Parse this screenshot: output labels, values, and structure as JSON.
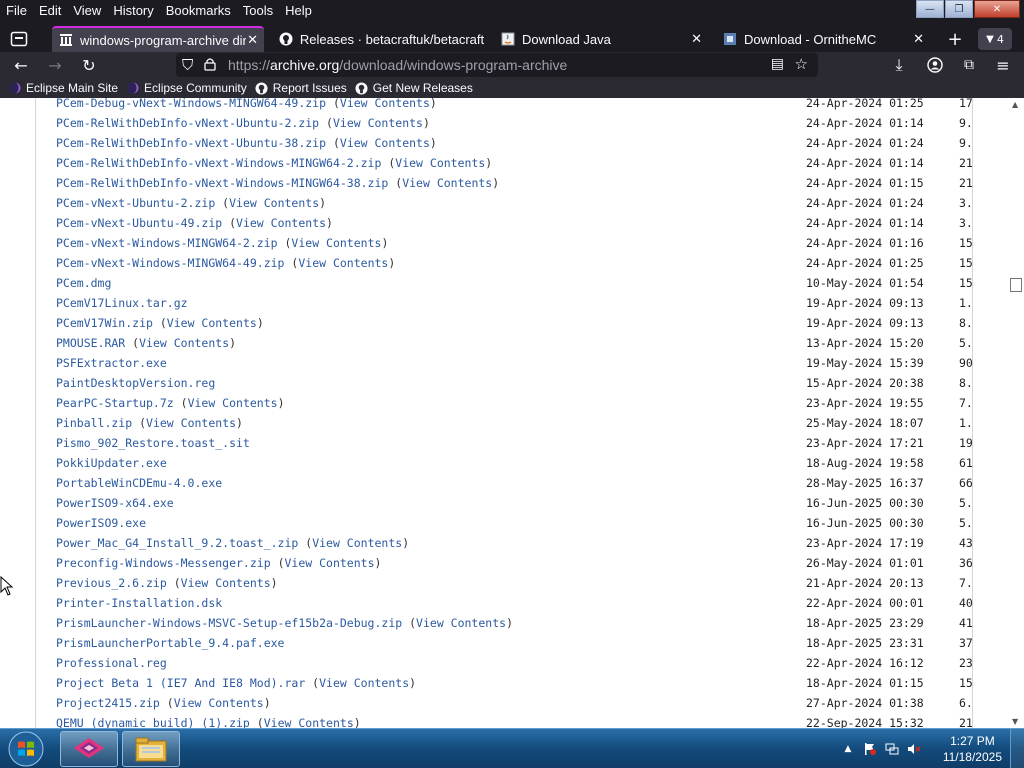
{
  "menubar": {
    "items": [
      "File",
      "Edit",
      "View",
      "History",
      "Bookmarks",
      "Tools",
      "Help"
    ]
  },
  "tabs": [
    {
      "label": "windows-program-archive dire",
      "icon": "archive-icon"
    },
    {
      "label": "Releases · betacraftuk/betacraft",
      "icon": "github-icon"
    },
    {
      "label": "Download Java",
      "icon": "java-icon"
    },
    {
      "label": "Download - OrnitheMC",
      "icon": "ornithe-icon"
    }
  ],
  "tabcount": "4",
  "url": {
    "prefix": "https://",
    "host": "archive.org",
    "path": "/download/windows-program-archive"
  },
  "bookmarks": [
    {
      "label": "Eclipse Main Site",
      "icon": "eclipse-icon"
    },
    {
      "label": "Eclipse Community",
      "icon": "eclipse-icon"
    },
    {
      "label": "Report Issues",
      "icon": "github-icon"
    },
    {
      "label": "Get New Releases",
      "icon": "github-icon"
    }
  ],
  "view_contents_label": "View Contents",
  "files": [
    {
      "name": "PCem-Debug-vNext-Windows-MINGW64-49.zip",
      "vc": true,
      "date": "24-Apr-2024 01:25",
      "size": "17"
    },
    {
      "name": "PCem-RelWithDebInfo-vNext-Ubuntu-2.zip",
      "vc": true,
      "date": "24-Apr-2024 01:14",
      "size": "9."
    },
    {
      "name": "PCem-RelWithDebInfo-vNext-Ubuntu-38.zip",
      "vc": true,
      "date": "24-Apr-2024 01:24",
      "size": "9."
    },
    {
      "name": "PCem-RelWithDebInfo-vNext-Windows-MINGW64-2.zip",
      "vc": true,
      "date": "24-Apr-2024 01:14",
      "size": "21"
    },
    {
      "name": "PCem-RelWithDebInfo-vNext-Windows-MINGW64-38.zip",
      "vc": true,
      "date": "24-Apr-2024 01:15",
      "size": "21"
    },
    {
      "name": "PCem-vNext-Ubuntu-2.zip",
      "vc": true,
      "date": "24-Apr-2024 01:24",
      "size": "3."
    },
    {
      "name": "PCem-vNext-Ubuntu-49.zip",
      "vc": true,
      "date": "24-Apr-2024 01:14",
      "size": "3."
    },
    {
      "name": "PCem-vNext-Windows-MINGW64-2.zip",
      "vc": true,
      "date": "24-Apr-2024 01:16",
      "size": "15"
    },
    {
      "name": "PCem-vNext-Windows-MINGW64-49.zip",
      "vc": true,
      "date": "24-Apr-2024 01:25",
      "size": "15"
    },
    {
      "name": "PCem.dmg",
      "vc": false,
      "date": "10-May-2024 01:54",
      "size": "15"
    },
    {
      "name": "PCemV17Linux.tar.gz",
      "vc": false,
      "date": "19-Apr-2024 09:13",
      "size": "1."
    },
    {
      "name": "PCemV17Win.zip",
      "vc": true,
      "date": "19-Apr-2024 09:13",
      "size": "8."
    },
    {
      "name": "PMOUSE.RAR",
      "vc": true,
      "date": "13-Apr-2024 15:20",
      "size": "5."
    },
    {
      "name": "PSFExtractor.exe",
      "vc": false,
      "date": "19-May-2024 15:39",
      "size": "90"
    },
    {
      "name": "PaintDesktopVersion.reg",
      "vc": false,
      "date": "15-Apr-2024 20:38",
      "size": "8."
    },
    {
      "name": "PearPC-Startup.7z",
      "vc": true,
      "date": "23-Apr-2024 19:55",
      "size": "7."
    },
    {
      "name": "Pinball.zip",
      "vc": true,
      "date": "25-May-2024 18:07",
      "size": "1."
    },
    {
      "name": "Pismo_902_Restore.toast_.sit",
      "vc": false,
      "date": "23-Apr-2024 17:21",
      "size": "19"
    },
    {
      "name": "PokkiUpdater.exe",
      "vc": false,
      "date": "18-Aug-2024 19:58",
      "size": "61"
    },
    {
      "name": "PortableWinCDEmu-4.0.exe",
      "vc": false,
      "date": "28-May-2025 16:37",
      "size": "66"
    },
    {
      "name": "PowerISO9-x64.exe",
      "vc": false,
      "date": "16-Jun-2025 00:30",
      "size": "5."
    },
    {
      "name": "PowerISO9.exe",
      "vc": false,
      "date": "16-Jun-2025 00:30",
      "size": "5."
    },
    {
      "name": "Power_Mac_G4_Install_9.2.toast_.zip",
      "vc": true,
      "date": "23-Apr-2024 17:19",
      "size": "43"
    },
    {
      "name": "Preconfig-Windows-Messenger.zip",
      "vc": true,
      "date": "26-May-2024 01:01",
      "size": "36"
    },
    {
      "name": "Previous_2.6.zip",
      "vc": true,
      "date": "21-Apr-2024 20:13",
      "size": "7."
    },
    {
      "name": "Printer-Installation.dsk",
      "vc": false,
      "date": "22-Apr-2024 00:01",
      "size": "40"
    },
    {
      "name": "PrismLauncher-Windows-MSVC-Setup-ef15b2a-Debug.zip",
      "vc": true,
      "date": "18-Apr-2025 23:29",
      "size": "41"
    },
    {
      "name": "PrismLauncherPortable_9.4.paf.exe",
      "vc": false,
      "date": "18-Apr-2025 23:31",
      "size": "37"
    },
    {
      "name": "Professional.reg",
      "vc": false,
      "date": "22-Apr-2024 16:12",
      "size": "23"
    },
    {
      "name": "Project Beta 1 (IE7 And IE8 Mod).rar",
      "vc": true,
      "date": "18-Apr-2024 01:15",
      "size": "15"
    },
    {
      "name": "Project2415.zip",
      "vc": true,
      "date": "27-Apr-2024 01:38",
      "size": "6."
    },
    {
      "name": "QEMU (dynamic build) (1).zip",
      "vc": true,
      "date": "22-Sep-2024 15:32",
      "size": "21"
    }
  ],
  "taskbar": {
    "clock_time": "1:27 PM",
    "clock_date": "11/18/2025",
    "apps": [
      {
        "name": "eclipse-app-icon"
      },
      {
        "name": "folder-app-icon"
      }
    ]
  }
}
